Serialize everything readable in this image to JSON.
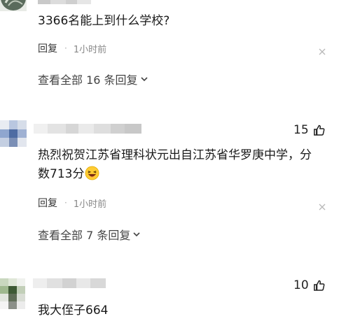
{
  "comments": [
    {
      "text": "3366名能上到什么学校?",
      "reply_label": "回复",
      "separator": "·",
      "time": "1小时前",
      "expand_label": "查看全部 16 条回复"
    },
    {
      "likes": "15",
      "text_line1": "热烈祝贺江苏省理科状元出自江苏省华罗庚中学，分",
      "text_line2": "数713分",
      "reply_label": "回复",
      "separator": "·",
      "time": "1小时前",
      "expand_label": "查看全部 7 条回复"
    },
    {
      "likes": "10",
      "text": "我大侄子664"
    }
  ],
  "icons": {
    "like": "thumbs-up-icon",
    "close": "close-icon",
    "expand": "chevron-down-icon",
    "emoji": "laughing-emoji"
  },
  "colors": {
    "text": "#1a1a1a",
    "meta": "#888888",
    "blur_gray": "#d8d8d8"
  }
}
